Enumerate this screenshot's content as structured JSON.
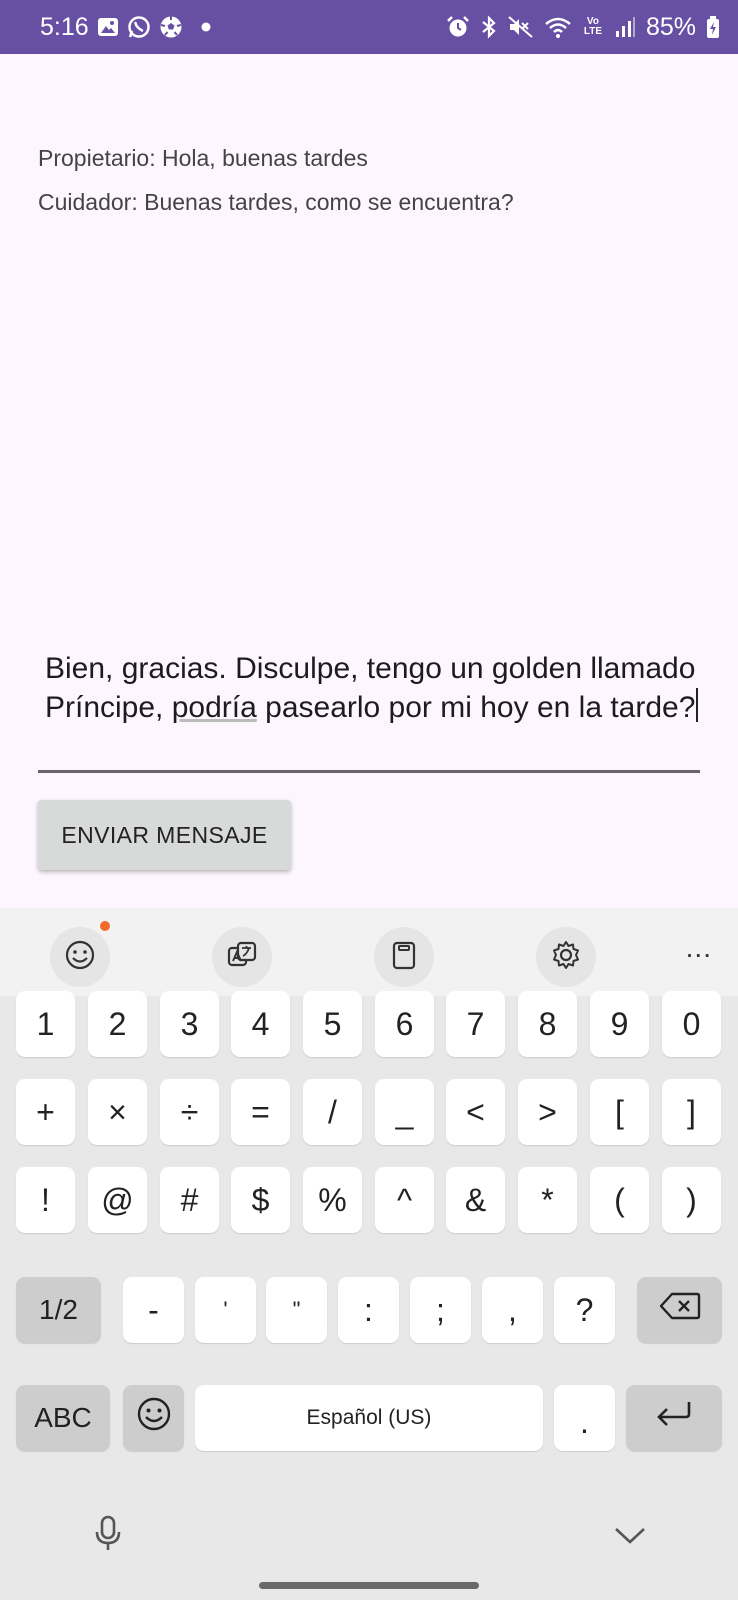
{
  "status_bar": {
    "time": "5:16",
    "left_icons": [
      "gallery-icon",
      "whatsapp-icon",
      "soccer-ball-icon",
      "notification-dot-icon"
    ],
    "right_icons": [
      "alarm-icon",
      "bluetooth-icon",
      "mute-icon",
      "wifi-icon",
      "volte-icon",
      "signal-icon"
    ],
    "volte_label": "Vo LTE",
    "battery": "85%",
    "color": "#6750a4"
  },
  "chat": {
    "messages": [
      "Propietario: Hola, buenas tardes",
      "Cuidador: Buenas tardes, como se encuentra?"
    ]
  },
  "composer": {
    "text_before": "Bien, gracias. Disculpe, tengo un golden llamado Príncipe, ",
    "text_underlined": "podría",
    "text_after": " pasearlo por mi hoy en la tarde?",
    "send_label": "ENVIAR MENSAJE"
  },
  "keyboard": {
    "toolbar": [
      "emoji-icon",
      "translate-icon",
      "clipboard-icon",
      "settings-icon"
    ],
    "more_label": "...",
    "row1": [
      "1",
      "2",
      "3",
      "4",
      "5",
      "6",
      "7",
      "8",
      "9",
      "0"
    ],
    "row2": [
      "+",
      "×",
      "÷",
      "=",
      "/",
      "_",
      "<",
      ">",
      "[",
      "]"
    ],
    "row3": [
      "!",
      "@",
      "#",
      "$",
      "%",
      "^",
      "&",
      "*",
      "(",
      ")"
    ],
    "row4": {
      "page_label": "1/2",
      "keys": [
        "-",
        "'",
        "\"",
        ":",
        ";",
        ",",
        "?"
      ]
    },
    "row5": {
      "abc_label": "ABC",
      "space_label": "Español (US)",
      "period_label": "."
    }
  }
}
